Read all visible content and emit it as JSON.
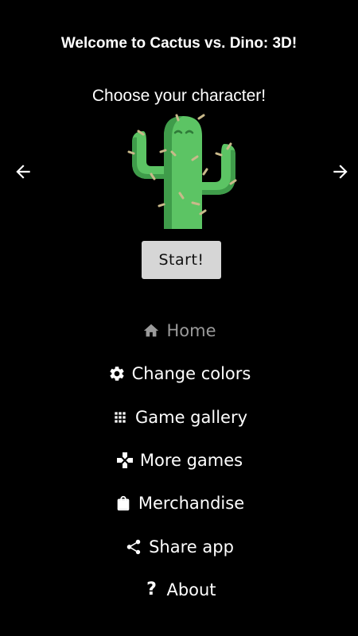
{
  "header": {
    "title": "Welcome to Cactus vs. Dino: 3D!",
    "subtitle": "Choose your character!"
  },
  "carousel": {
    "prev_icon": "arrow-left-icon",
    "next_icon": "arrow-right-icon",
    "character_icon": "cactus-icon",
    "colors": {
      "cactus_main": "#5cc464",
      "cactus_dark": "#3f9c4a",
      "spines": "#c9b98a"
    }
  },
  "start_button": {
    "label": "Start!"
  },
  "menu": {
    "items": [
      {
        "label": "Home",
        "icon": "home-icon",
        "active": true
      },
      {
        "label": "Change colors",
        "icon": "gear-icon"
      },
      {
        "label": "Game gallery",
        "icon": "grid-icon"
      },
      {
        "label": "More games",
        "icon": "gamepad-icon"
      },
      {
        "label": "Merchandise",
        "icon": "shopping-bag-icon"
      },
      {
        "label": "Share app",
        "icon": "share-icon"
      },
      {
        "label": "About",
        "icon": "question-mark-icon",
        "glyph": "?"
      }
    ],
    "active_color": "#9a9a9a",
    "text_color": "#ffffff"
  }
}
